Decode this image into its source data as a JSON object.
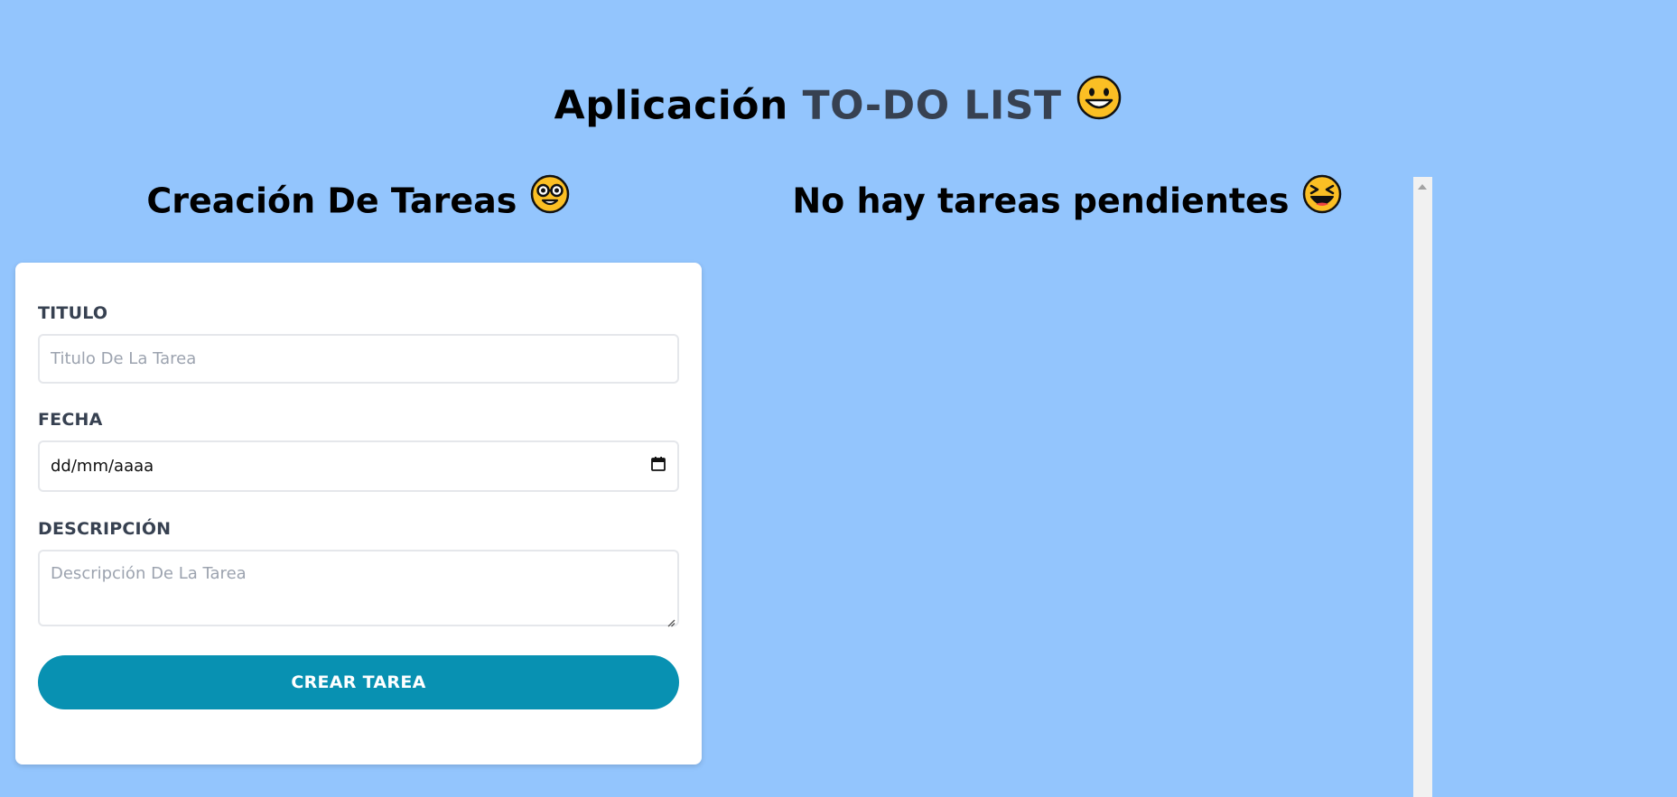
{
  "header": {
    "title_prefix": "Aplicación",
    "title_accent": "TO-DO LIST",
    "title_emoji": "😄"
  },
  "form_section": {
    "title": "Creación De Tareas",
    "title_emoji": "🤓",
    "fields": {
      "titulo": {
        "label": "TITULO",
        "placeholder": "Titulo De La Tarea",
        "value": ""
      },
      "fecha": {
        "label": "FECHA",
        "display": "dd/mm/aaaa"
      },
      "descripcion": {
        "label": "DESCRIPCIÓN",
        "placeholder": "Descripción De La Tarea",
        "value": ""
      }
    },
    "submit_label": "CREAR TAREA"
  },
  "tasks_section": {
    "title": "No hay tareas pendientes",
    "title_emoji": "😆"
  },
  "colors": {
    "background": "#93c5fd",
    "accent_text": "#374151",
    "button": "#0891b2",
    "card": "#ffffff"
  },
  "icons": {
    "calendar": "calendar-icon",
    "resize": "resize-grip-icon",
    "scroll_up": "scroll-up-arrow-icon"
  }
}
